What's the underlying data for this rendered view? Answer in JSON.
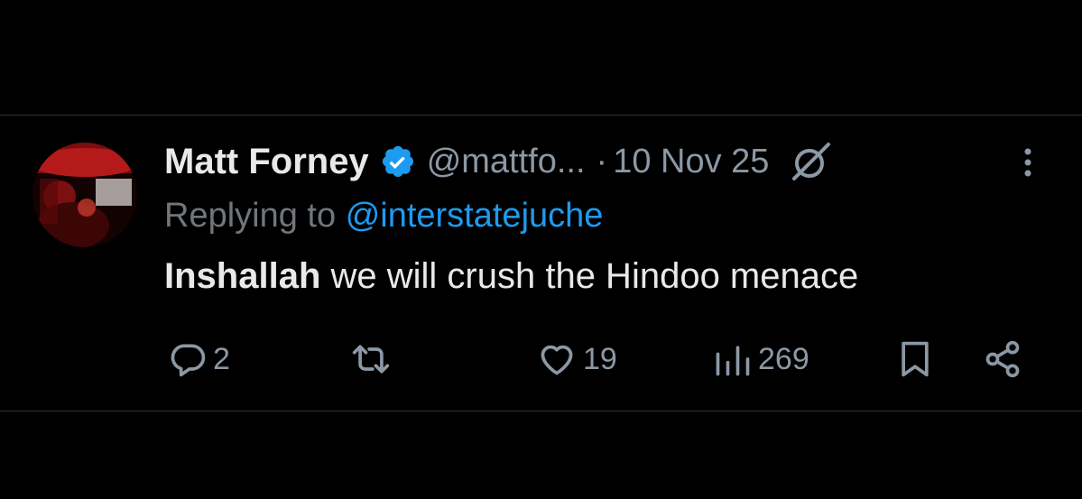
{
  "tweet": {
    "author": {
      "display_name": "Matt Forney",
      "handle": "@mattfo...",
      "verified": true,
      "avatar_icon": "profile-photo"
    },
    "separator": "·",
    "date": "10 Nov 25",
    "reply": {
      "prefix": "Replying to",
      "mention": "@interstatejuche"
    },
    "text": {
      "bold_part": "Inshallah",
      "rest": " we will crush the Hindoo menace"
    },
    "actions": {
      "replies": "2",
      "retweets": "",
      "likes": "19",
      "views": "269"
    }
  },
  "colors": {
    "background": "#000000",
    "primary_text": "#e7e9ea",
    "secondary_text": "#8b98a5",
    "link": "#1d9bf0",
    "verified_badge": "#1d9bf0",
    "divider": "#2f3336"
  },
  "icons": [
    "verified-badge-icon",
    "grok-icon",
    "more-icon",
    "reply-icon",
    "retweet-icon",
    "like-icon",
    "views-icon",
    "bookmark-icon",
    "share-icon"
  ]
}
